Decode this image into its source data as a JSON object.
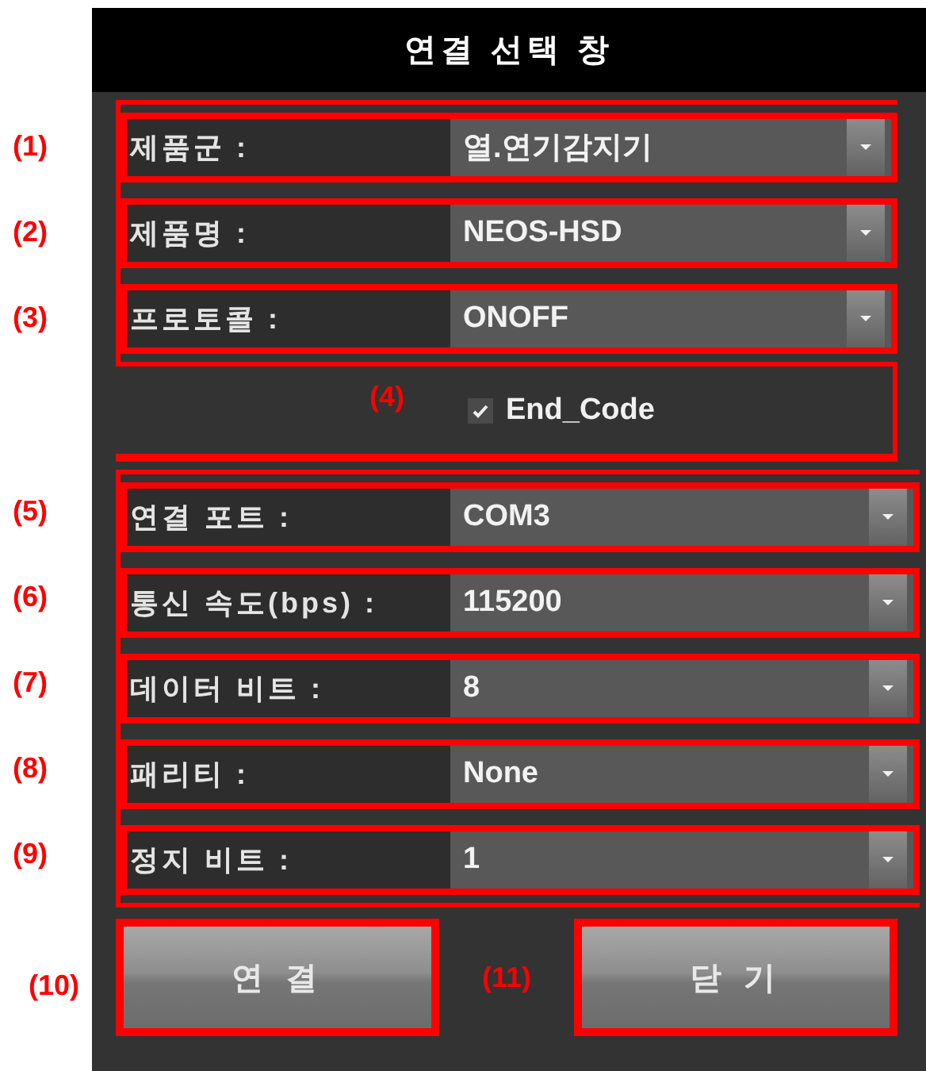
{
  "window": {
    "title": "연결 선택 창"
  },
  "product_fields": [
    {
      "marker": "(1)",
      "label": "제품군 :",
      "value": "열.연기감지기"
    },
    {
      "marker": "(2)",
      "label": "제품명 :",
      "value": "NEOS-HSD"
    },
    {
      "marker": "(3)",
      "label": "프로토콜 :",
      "value": "ONOFF"
    }
  ],
  "checkbox": {
    "marker": "(4)",
    "label": "End_Code",
    "checked": true
  },
  "serial_fields": [
    {
      "marker": "(5)",
      "label": "연결 포트 :",
      "value": "COM3"
    },
    {
      "marker": "(6)",
      "label": "통신 속도(bps) :",
      "value": "115200"
    },
    {
      "marker": "(7)",
      "label": "데이터 비트 :",
      "value": "8"
    },
    {
      "marker": "(8)",
      "label": "패리티 :",
      "value": "None"
    },
    {
      "marker": "(9)",
      "label": "정지 비트 :",
      "value": "1"
    }
  ],
  "buttons": [
    {
      "marker": "(10)",
      "label": "연 결"
    },
    {
      "marker": "(11)",
      "label": "닫 기"
    }
  ]
}
